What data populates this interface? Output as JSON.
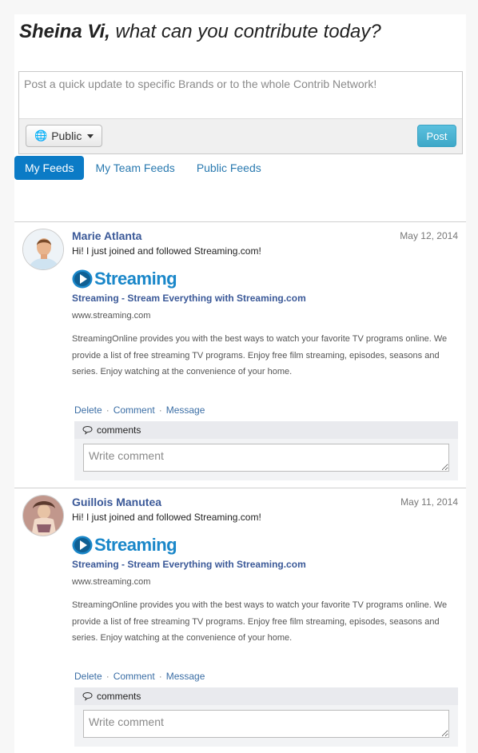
{
  "header": {
    "user_name": "Sheina Vi,",
    "prompt": " what can you contribute today?"
  },
  "composer": {
    "placeholder": "Post a quick update to specific Brands or to the whole Contrib Network!",
    "privacy_label": "Public",
    "post_label": "Post"
  },
  "tabs": [
    {
      "label": "My Feeds",
      "active": true
    },
    {
      "label": "My Team Feeds",
      "active": false
    },
    {
      "label": "Public Feeds",
      "active": false
    }
  ],
  "posts": [
    {
      "author": "Marie Atlanta",
      "date": "May 12, 2014",
      "message": "Hi! I just joined and followed Streaming.com!",
      "logo_text": "Streaming",
      "link_title": "Streaming - Stream Everything with Streaming.com",
      "link_url": "www.streaming.com",
      "link_desc": "StreamingOnline provides you with the best ways to watch your favorite TV programs online. We provide a list of free streaming TV programs. Enjoy free film streaming, episodes, seasons and series. Enjoy watching at the convenience of your home.",
      "actions": {
        "delete": "Delete",
        "comment": "Comment",
        "message": "Message"
      },
      "comments_label": "comments",
      "comment_placeholder": "Write comment"
    },
    {
      "author": "Guillois Manutea",
      "date": "May 11, 2014",
      "message": "Hi! I just joined and followed Streaming.com!",
      "logo_text": "Streaming",
      "link_title": "Streaming - Stream Everything with Streaming.com",
      "link_url": "www.streaming.com",
      "link_desc": "StreamingOnline provides you with the best ways to watch your favorite TV programs online. We provide a list of free streaming TV programs. Enjoy free film streaming, episodes, seasons and series. Enjoy watching at the convenience of your home.",
      "actions": {
        "delete": "Delete",
        "comment": "Comment",
        "message": "Message"
      },
      "comments_label": "comments",
      "comment_placeholder": "Write comment"
    }
  ],
  "colors": {
    "accent": "#0b7bc6",
    "link": "#3b5998",
    "post_button": "#5bc0de",
    "logo": "#1a87c9"
  }
}
